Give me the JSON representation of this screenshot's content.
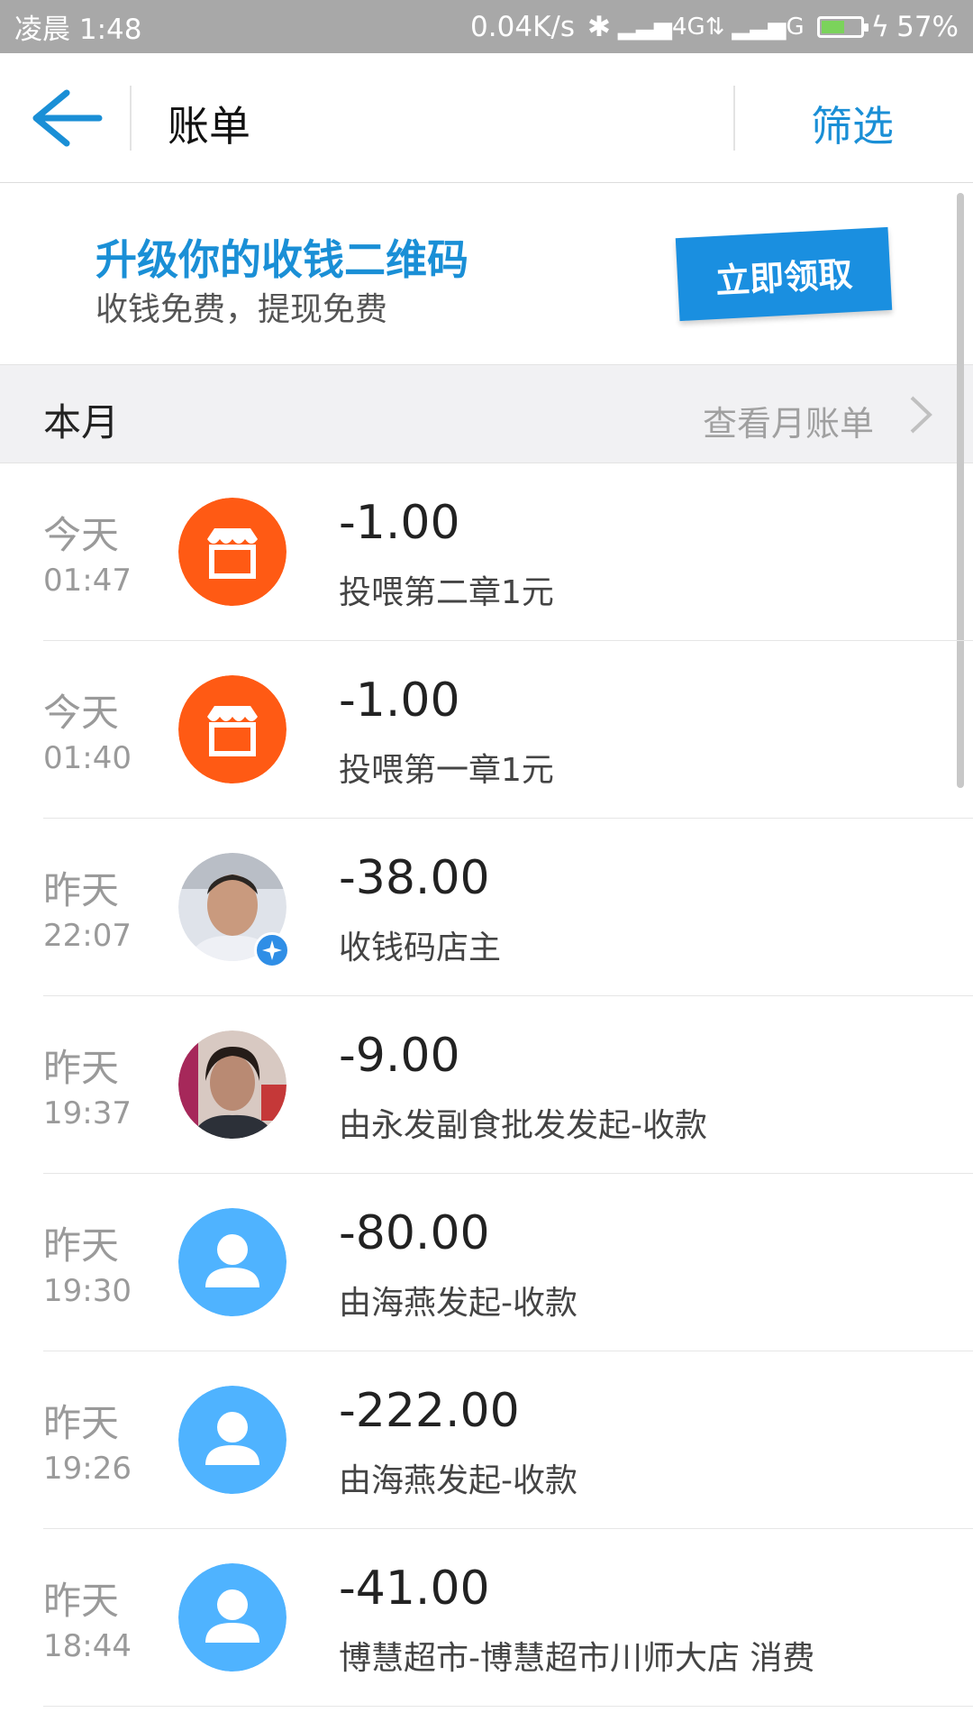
{
  "status_bar": {
    "time": "凌晨 1:48",
    "net_speed": "0.04K/s",
    "net_4g": "4G",
    "net_g": "G",
    "battery_level": 0.57,
    "battery_text": "57%"
  },
  "header": {
    "title": "账单",
    "filter_label": "筛选"
  },
  "promo": {
    "title": "升级你的收钱二维码",
    "subtitle": "收钱免费，提现免费",
    "button_label": "立即领取"
  },
  "month": {
    "label": "本月",
    "link_label": "查看月账单"
  },
  "transactions": [
    {
      "day": "今天",
      "time": "01:47",
      "amount": "-1.00",
      "desc": "投喂第二章1元",
      "icon": "store-icon"
    },
    {
      "day": "今天",
      "time": "01:40",
      "amount": "-1.00",
      "desc": "投喂第一章1元",
      "icon": "store-icon"
    },
    {
      "day": "昨天",
      "time": "22:07",
      "amount": "-38.00",
      "desc": "收钱码店主",
      "icon": "user-photo"
    },
    {
      "day": "昨天",
      "time": "19:37",
      "amount": "-9.00",
      "desc": "由永发副食批发发起-收款",
      "icon": "user-photo"
    },
    {
      "day": "昨天",
      "time": "19:30",
      "amount": "-80.00",
      "desc": "由海燕发起-收款",
      "icon": "person-icon"
    },
    {
      "day": "昨天",
      "time": "19:26",
      "amount": "-222.00",
      "desc": "由海燕发起-收款",
      "icon": "person-icon"
    },
    {
      "day": "昨天",
      "time": "18:44",
      "amount": "-41.00",
      "desc": "博慧超市-博慧超市川师大店 消费",
      "icon": "person-icon"
    }
  ],
  "colors": {
    "accent": "#1a8fd6",
    "store_orange": "#ff5a14",
    "person_blue": "#4fb3ff"
  }
}
